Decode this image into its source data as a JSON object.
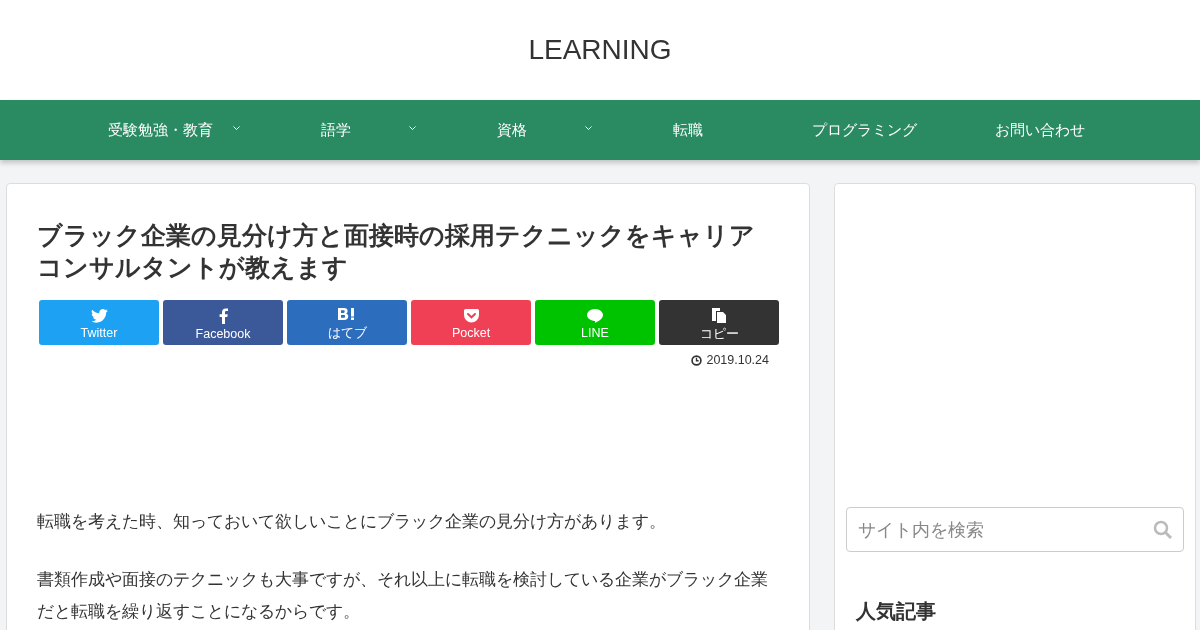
{
  "site_title": "LEARNING",
  "nav": [
    {
      "label": "受験勉強・教育",
      "dropdown": true
    },
    {
      "label": "語学",
      "dropdown": true
    },
    {
      "label": "資格",
      "dropdown": true
    },
    {
      "label": "転職",
      "dropdown": false
    },
    {
      "label": "プログラミング",
      "dropdown": false
    },
    {
      "label": "お問い合わせ",
      "dropdown": false
    }
  ],
  "article": {
    "title": "ブラック企業の見分け方と面接時の採用テクニックをキャリアコンサルタントが教えます",
    "share_buttons": [
      {
        "kind": "twitter",
        "label": "Twitter",
        "color": "#1da1f2"
      },
      {
        "kind": "facebook",
        "label": "Facebook",
        "color": "#3b5998"
      },
      {
        "kind": "hatena",
        "label": "はてブ",
        "color": "#2c6ebd"
      },
      {
        "kind": "pocket",
        "label": "Pocket",
        "color": "#ef4056"
      },
      {
        "kind": "line",
        "label": "LINE",
        "color": "#00c300"
      },
      {
        "kind": "copy",
        "label": "コピー",
        "color": "#333333"
      }
    ],
    "date": "2019.10.24",
    "paragraphs": [
      "転職を考えた時、知っておいて欲しいことにブラック企業の見分け方があります。",
      "書類作成や面接のテクニックも大事ですが、それ以上に転職を検討している企業がブラック企業だと転職を繰り返すことになるからです。"
    ]
  },
  "sidebar": {
    "search": {
      "placeholder": "サイト内を検索"
    },
    "heading": "人気記事"
  }
}
